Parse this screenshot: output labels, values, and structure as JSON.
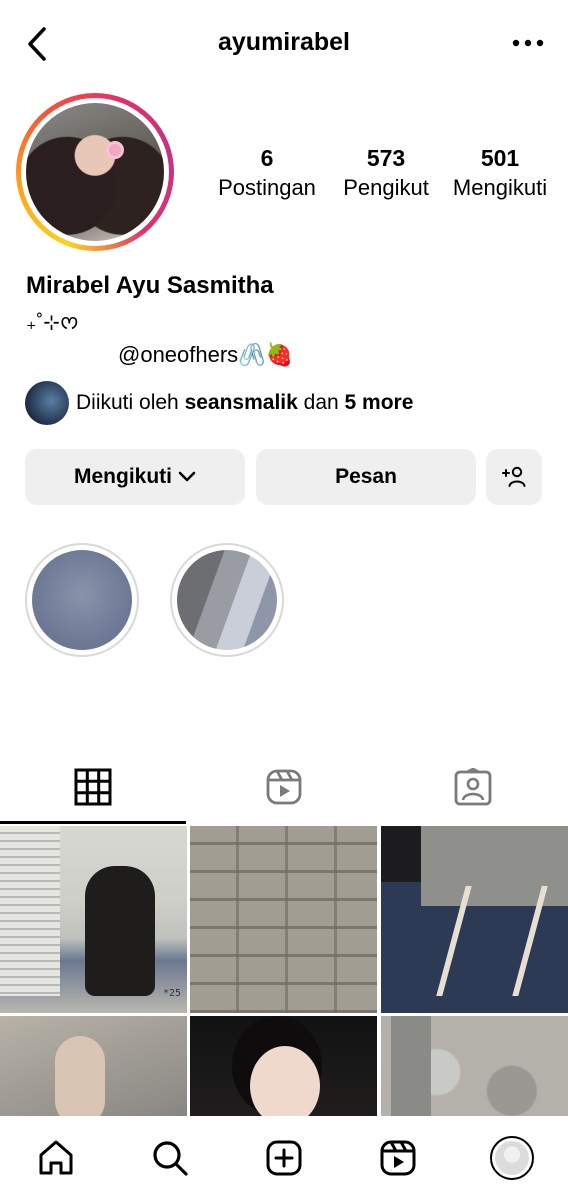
{
  "header": {
    "username": "ayumirabel"
  },
  "stats": {
    "posts_count": "6",
    "posts_label": "Postingan",
    "followers_count": "573",
    "followers_label": "Pengikut",
    "following_count": "501",
    "following_label": "Mengikuti"
  },
  "profile": {
    "full_name": "Mirabel Ayu Sasmitha",
    "bio_line1": "₊˚⊹ᰔ",
    "bio_line2": "@oneofhers🖇️🍓"
  },
  "followed_by": {
    "prefix": "Diikuti oleh ",
    "user": "seansmalik",
    "middle": " dan ",
    "more": "5 more"
  },
  "actions": {
    "following_label": "Mengikuti",
    "message_label": "Pesan"
  },
  "tabs": [
    "grid-icon",
    "reels-icon",
    "tagged-icon"
  ],
  "bottom_nav": [
    "home-icon",
    "search-icon",
    "create-icon",
    "reels-icon",
    "profile-avatar"
  ],
  "grid_watermark": "*25"
}
